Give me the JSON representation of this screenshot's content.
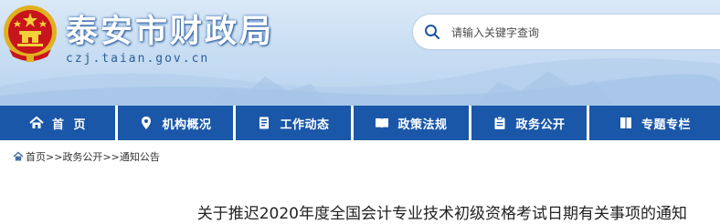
{
  "header": {
    "site_title": "泰安市财政局",
    "site_domain": "czj.taian.gov.cn",
    "emblem_icon": "national-emblem-icon",
    "search": {
      "placeholder": "请输入关键字查询",
      "icon": "search-icon"
    }
  },
  "nav": {
    "items": [
      {
        "label": "首  页",
        "icon": "home-icon"
      },
      {
        "label": "机构概况",
        "icon": "location-pin-icon"
      },
      {
        "label": "工作动态",
        "icon": "document-icon"
      },
      {
        "label": "政策法规",
        "icon": "book-icon"
      },
      {
        "label": "政务公开",
        "icon": "clipboard-icon"
      },
      {
        "label": "专题专栏",
        "icon": "open-book-icon"
      }
    ]
  },
  "breadcrumb": {
    "items": [
      "首页",
      "政务公开",
      "通知公告"
    ],
    "separator": ">>"
  },
  "article": {
    "title": "关于推迟2020年度全国会计专业技术初级资格考试日期有关事项的通知"
  },
  "colors": {
    "nav_bg": "#1a57a8",
    "header_bg": "#c9def3",
    "title_text": "#ffffff"
  }
}
